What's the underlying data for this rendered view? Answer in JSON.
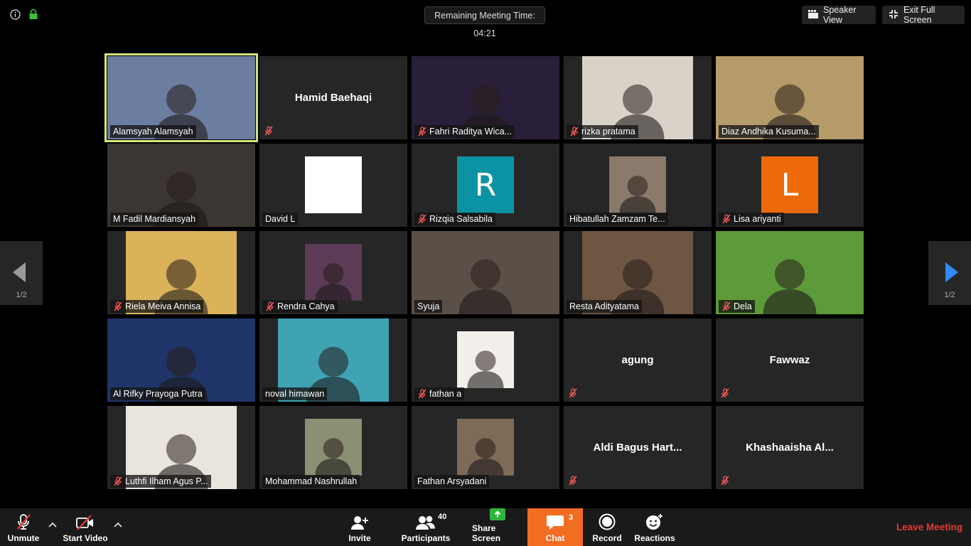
{
  "topbar": {
    "info_icon": "info-icon",
    "lock_icon": "encryption-lock-icon",
    "timer": "Remaining Meeting Time: 04:21",
    "speaker_view": "Speaker View",
    "exit_full_screen": "Exit Full Screen"
  },
  "participants": [
    {
      "name": "Alamsyah Alamsyah",
      "type": "video",
      "muted": false,
      "active": true,
      "bg": "#6b7da0"
    },
    {
      "name": "Hamid Baehaqi",
      "type": "name",
      "muted": true
    },
    {
      "name": "Fahri Raditya Wica...",
      "type": "video",
      "muted": true,
      "bg": "#2a1f3a"
    },
    {
      "name": "rizka pratama",
      "type": "video-narrow",
      "muted": true,
      "bg": "#d8d2c8"
    },
    {
      "name": "Diaz Andhika Kusuma...",
      "type": "video",
      "muted": false,
      "bg": "#b59a6a"
    },
    {
      "name": "M Fadil Mardiansyah",
      "type": "video",
      "muted": false,
      "bg": "#3b3631"
    },
    {
      "name": "David L",
      "type": "avatar",
      "muted": false,
      "avatar_color": "#ffffff",
      "initial": ""
    },
    {
      "name": "Rizqia Salsabila",
      "type": "avatar",
      "muted": true,
      "avatar_color": "#0c93a3",
      "initial": "R"
    },
    {
      "name": "Hibatullah Zamzam Te...",
      "type": "photo",
      "muted": false,
      "bg": "#8a7a6b"
    },
    {
      "name": "Lisa ariyanti",
      "type": "avatar",
      "muted": true,
      "avatar_color": "#ec6a0c",
      "initial": "L"
    },
    {
      "name": "Riela Meiva Annisa",
      "type": "video-narrow",
      "muted": true,
      "bg": "#d9b25a"
    },
    {
      "name": "Rendra Cahya",
      "type": "photo",
      "muted": true,
      "bg": "#5b3b55"
    },
    {
      "name": "Syuja",
      "type": "video",
      "muted": false,
      "bg": "#5b5048"
    },
    {
      "name": "Resta Adityatama",
      "type": "video-narrow",
      "muted": false,
      "bg": "#6e5643"
    },
    {
      "name": "Dela",
      "type": "video",
      "muted": true,
      "bg": "#5d9a3a"
    },
    {
      "name": "Al Rifky Prayoga Putra",
      "type": "video",
      "muted": false,
      "bg": "#1f3569"
    },
    {
      "name": "noval himawan",
      "type": "video-narrow",
      "muted": false,
      "bg": "#3fa3b4"
    },
    {
      "name": "fathan a",
      "type": "photo",
      "muted": true,
      "bg": "#f2efea"
    },
    {
      "name": "agung",
      "type": "name",
      "muted": true
    },
    {
      "name": "Fawwaz",
      "type": "name",
      "muted": true
    },
    {
      "name": "Luthfi Ilham Agus P...",
      "type": "video-narrow",
      "muted": true,
      "bg": "#e9e4dc"
    },
    {
      "name": "Mohammad Nashrullah",
      "type": "photo",
      "muted": false,
      "bg": "#8b8f74"
    },
    {
      "name": "Fathan Arsyadani",
      "type": "photo",
      "muted": false,
      "bg": "#7d6a57"
    },
    {
      "name": "Aldi Bagus Hart...",
      "type": "name",
      "muted": true
    },
    {
      "name": "Khashaaisha Al...",
      "type": "name",
      "muted": true
    }
  ],
  "pager": {
    "left_page": "1/2",
    "right_page": "1/2",
    "left_arrow_color": "#9a9a9a",
    "right_arrow_color": "#2d8cff"
  },
  "toolbar": {
    "unmute": "Unmute",
    "start_video": "Start Video",
    "invite": "Invite",
    "participants": "Participants",
    "participants_count": "40",
    "share_screen": "Share Screen",
    "chat": "Chat",
    "chat_count": "3",
    "record": "Record",
    "reactions": "Reactions",
    "leave": "Leave Meeting",
    "chat_bg": "#f26d21",
    "share_green": "#2fb53c",
    "leave_color": "#e53935"
  }
}
